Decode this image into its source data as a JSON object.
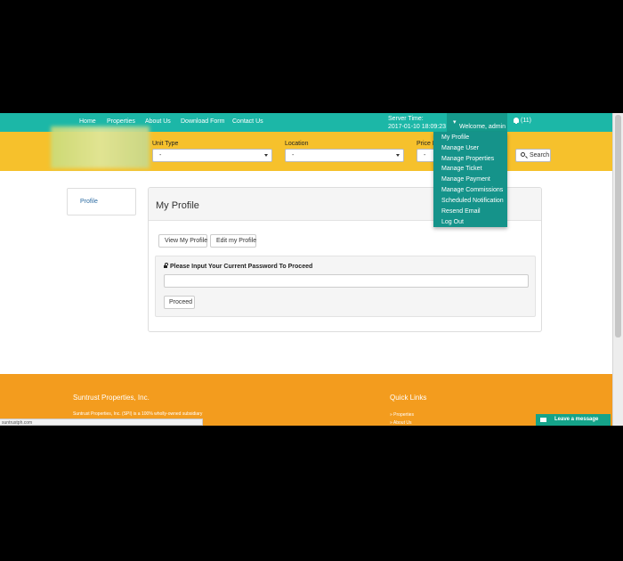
{
  "nav": {
    "links": [
      "Home",
      "Properties",
      "About Us",
      "Download Form",
      "Contact Us"
    ],
    "server_time_label": "Server Time:",
    "server_time_value": "2017-01-10 18:09:23",
    "welcome": "Welcome, admin",
    "notifications": "(11)"
  },
  "search": {
    "unit_type_label": "Unit Type",
    "unit_type_value": "-",
    "location_label": "Location",
    "location_value": "-",
    "price_label": "Price R",
    "price_value": "-",
    "button": "Search"
  },
  "user_menu": {
    "items": [
      "My Profile",
      "Manage User",
      "Manage Properties",
      "Manage Ticket",
      "Manage Payment",
      "Manage Commissions",
      "Scheduled Notification",
      "Resend Email",
      "Log Out"
    ]
  },
  "sidebar": {
    "item": "Profile"
  },
  "panel": {
    "title": "My Profile",
    "tabs": [
      "View My Profile",
      "Edit my Profile"
    ],
    "password_label": "Please Input Your Current Password To Proceed",
    "password_value": "",
    "proceed": "Proceed"
  },
  "footer": {
    "company": "Suntrust Properties, Inc.",
    "text": "Suntrust Properties, Inc. (SPI) is a 100% wholly-owned subsidiary",
    "quick_links_title": "Quick Links",
    "quick_links": [
      "» Properties",
      "» About Us"
    ]
  },
  "status_url": "suntrustph.com",
  "chat": "Leave a message",
  "colors": {
    "teal": "#1cb7a7",
    "yellow": "#f6c12c",
    "orange": "#f39c1e",
    "menu": "#15938a"
  }
}
